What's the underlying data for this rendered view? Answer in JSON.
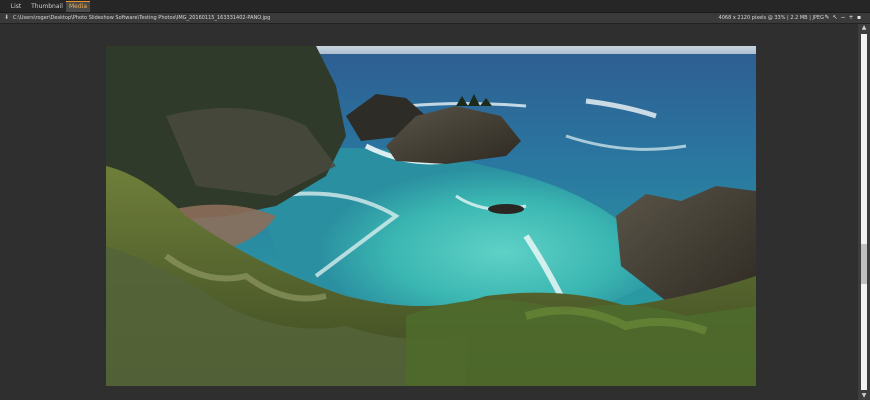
{
  "tabs": [
    {
      "label": "List",
      "active": false
    },
    {
      "label": "Thumbnail",
      "active": false
    },
    {
      "label": "Media",
      "active": true
    }
  ],
  "path": "C:\\Users\\roger\\Desktop\\Photo Slideshow Software\\Testing Photos\\IMG_20160115_163331402-PANO.jpg",
  "info": "4068 x 2120 pixels @ 33%  |  2.2 MB  |  JPEG",
  "toolbar_icons": [
    "pin-icon",
    "fit-icon",
    "zoom-out-icon",
    "zoom-in-icon",
    "fullscreen-icon"
  ],
  "colors": {
    "accent": "#e8912b",
    "background": "#2f2f2f"
  },
  "photo": {
    "description_icon": "landscape-photo"
  }
}
